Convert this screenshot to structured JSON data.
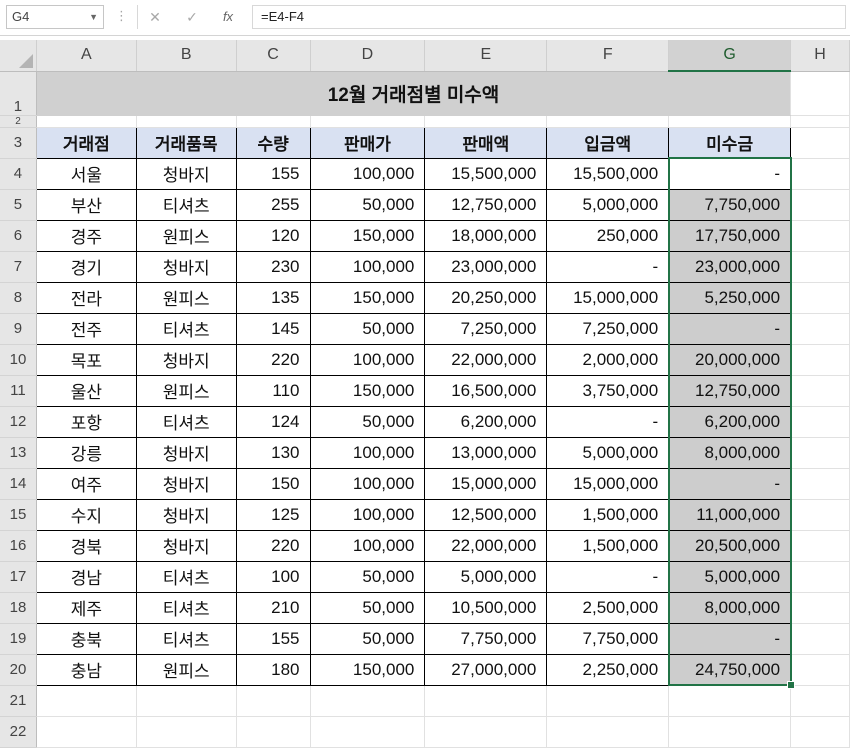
{
  "formula_bar": {
    "name_box": "G4",
    "cancel_icon": "✕",
    "enter_icon": "✓",
    "fx_label": "fx",
    "formula": "=E4-F4"
  },
  "columns": [
    "A",
    "B",
    "C",
    "D",
    "E",
    "F",
    "G",
    "H"
  ],
  "selected_column": "G",
  "title": "12월 거래점별 미수액",
  "headers": [
    "거래점",
    "거래품목",
    "수량",
    "판매가",
    "판매액",
    "입금액",
    "미수금"
  ],
  "rows": [
    {
      "r": "4",
      "store": "서울",
      "item": "청바지",
      "qty": "155",
      "price": "100,000",
      "sales": "15,500,000",
      "paid": "15,500,000",
      "due": "-"
    },
    {
      "r": "5",
      "store": "부산",
      "item": "티셔츠",
      "qty": "255",
      "price": "50,000",
      "sales": "12,750,000",
      "paid": "5,000,000",
      "due": "7,750,000"
    },
    {
      "r": "6",
      "store": "경주",
      "item": "원피스",
      "qty": "120",
      "price": "150,000",
      "sales": "18,000,000",
      "paid": "250,000",
      "due": "17,750,000"
    },
    {
      "r": "7",
      "store": "경기",
      "item": "청바지",
      "qty": "230",
      "price": "100,000",
      "sales": "23,000,000",
      "paid": "-",
      "due": "23,000,000"
    },
    {
      "r": "8",
      "store": "전라",
      "item": "원피스",
      "qty": "135",
      "price": "150,000",
      "sales": "20,250,000",
      "paid": "15,000,000",
      "due": "5,250,000"
    },
    {
      "r": "9",
      "store": "전주",
      "item": "티셔츠",
      "qty": "145",
      "price": "50,000",
      "sales": "7,250,000",
      "paid": "7,250,000",
      "due": "-"
    },
    {
      "r": "10",
      "store": "목포",
      "item": "청바지",
      "qty": "220",
      "price": "100,000",
      "sales": "22,000,000",
      "paid": "2,000,000",
      "due": "20,000,000"
    },
    {
      "r": "11",
      "store": "울산",
      "item": "원피스",
      "qty": "110",
      "price": "150,000",
      "sales": "16,500,000",
      "paid": "3,750,000",
      "due": "12,750,000"
    },
    {
      "r": "12",
      "store": "포항",
      "item": "티셔츠",
      "qty": "124",
      "price": "50,000",
      "sales": "6,200,000",
      "paid": "-",
      "due": "6,200,000"
    },
    {
      "r": "13",
      "store": "강릉",
      "item": "청바지",
      "qty": "130",
      "price": "100,000",
      "sales": "13,000,000",
      "paid": "5,000,000",
      "due": "8,000,000"
    },
    {
      "r": "14",
      "store": "여주",
      "item": "청바지",
      "qty": "150",
      "price": "100,000",
      "sales": "15,000,000",
      "paid": "15,000,000",
      "due": "-"
    },
    {
      "r": "15",
      "store": "수지",
      "item": "청바지",
      "qty": "125",
      "price": "100,000",
      "sales": "12,500,000",
      "paid": "1,500,000",
      "due": "11,000,000"
    },
    {
      "r": "16",
      "store": "경북",
      "item": "청바지",
      "qty": "220",
      "price": "100,000",
      "sales": "22,000,000",
      "paid": "1,500,000",
      "due": "20,500,000"
    },
    {
      "r": "17",
      "store": "경남",
      "item": "티셔츠",
      "qty": "100",
      "price": "50,000",
      "sales": "5,000,000",
      "paid": "-",
      "due": "5,000,000"
    },
    {
      "r": "18",
      "store": "제주",
      "item": "티셔츠",
      "qty": "210",
      "price": "50,000",
      "sales": "10,500,000",
      "paid": "2,500,000",
      "due": "8,000,000"
    },
    {
      "r": "19",
      "store": "충북",
      "item": "티셔츠",
      "qty": "155",
      "price": "50,000",
      "sales": "7,750,000",
      "paid": "7,750,000",
      "due": "-"
    },
    {
      "r": "20",
      "store": "충남",
      "item": "원피스",
      "qty": "180",
      "price": "150,000",
      "sales": "27,000,000",
      "paid": "2,250,000",
      "due": "24,750,000"
    }
  ],
  "row_labels": {
    "r1": "1",
    "r2": "2",
    "r3": "3",
    "r21": "21",
    "r22": "22"
  },
  "colors": {
    "header_fill": "#d9e1f2",
    "title_fill": "#d0d0d0",
    "due_fill": "#cdcdcd",
    "selection": "#217346"
  }
}
